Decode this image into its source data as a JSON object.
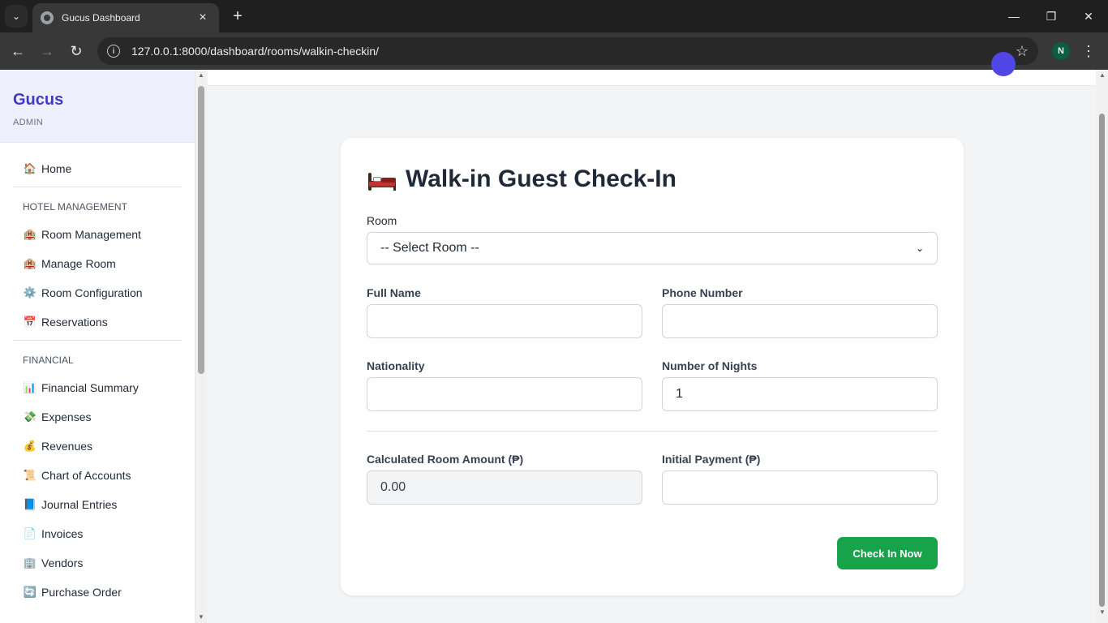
{
  "browser": {
    "tab_title": "Gucus Dashboard",
    "url": "127.0.0.1:8000/dashboard/rooms/walkin-checkin/",
    "profile_initial": "N"
  },
  "sidebar": {
    "brand": "Gucus",
    "role": "ADMIN",
    "home": {
      "icon": "🏠",
      "label": "Home"
    },
    "sections": [
      {
        "title": "HOTEL MANAGEMENT",
        "items": [
          {
            "icon": "🏨",
            "label": "Room Management"
          },
          {
            "icon": "🏨",
            "label": "Manage Room"
          },
          {
            "icon": "⚙️",
            "label": "Room Configuration"
          },
          {
            "icon": "📅",
            "label": "Reservations"
          }
        ]
      },
      {
        "title": "FINANCIAL",
        "items": [
          {
            "icon": "📊",
            "label": "Financial Summary"
          },
          {
            "icon": "💸",
            "label": "Expenses"
          },
          {
            "icon": "💰",
            "label": "Revenues"
          },
          {
            "icon": "📜",
            "label": "Chart of Accounts"
          },
          {
            "icon": "📘",
            "label": "Journal Entries"
          },
          {
            "icon": "📄",
            "label": "Invoices"
          },
          {
            "icon": "🏢",
            "label": "Vendors"
          },
          {
            "icon": "🔄",
            "label": "Purchase Order"
          }
        ]
      }
    ]
  },
  "form": {
    "title": "Walk-in Guest Check-In",
    "room_label": "Room",
    "room_value": "-- Select Room --",
    "full_name_label": "Full Name",
    "full_name_value": "",
    "phone_label": "Phone Number",
    "phone_value": "",
    "nationality_label": "Nationality",
    "nationality_value": "",
    "nights_label": "Number of Nights",
    "nights_value": "1",
    "amount_label": "Calculated Room Amount (₱)",
    "amount_value": "0.00",
    "payment_label": "Initial Payment (₱)",
    "payment_value": "",
    "submit_label": "Check In Now"
  },
  "colors": {
    "brand": "#4338ca",
    "submit": "#16a34a"
  }
}
